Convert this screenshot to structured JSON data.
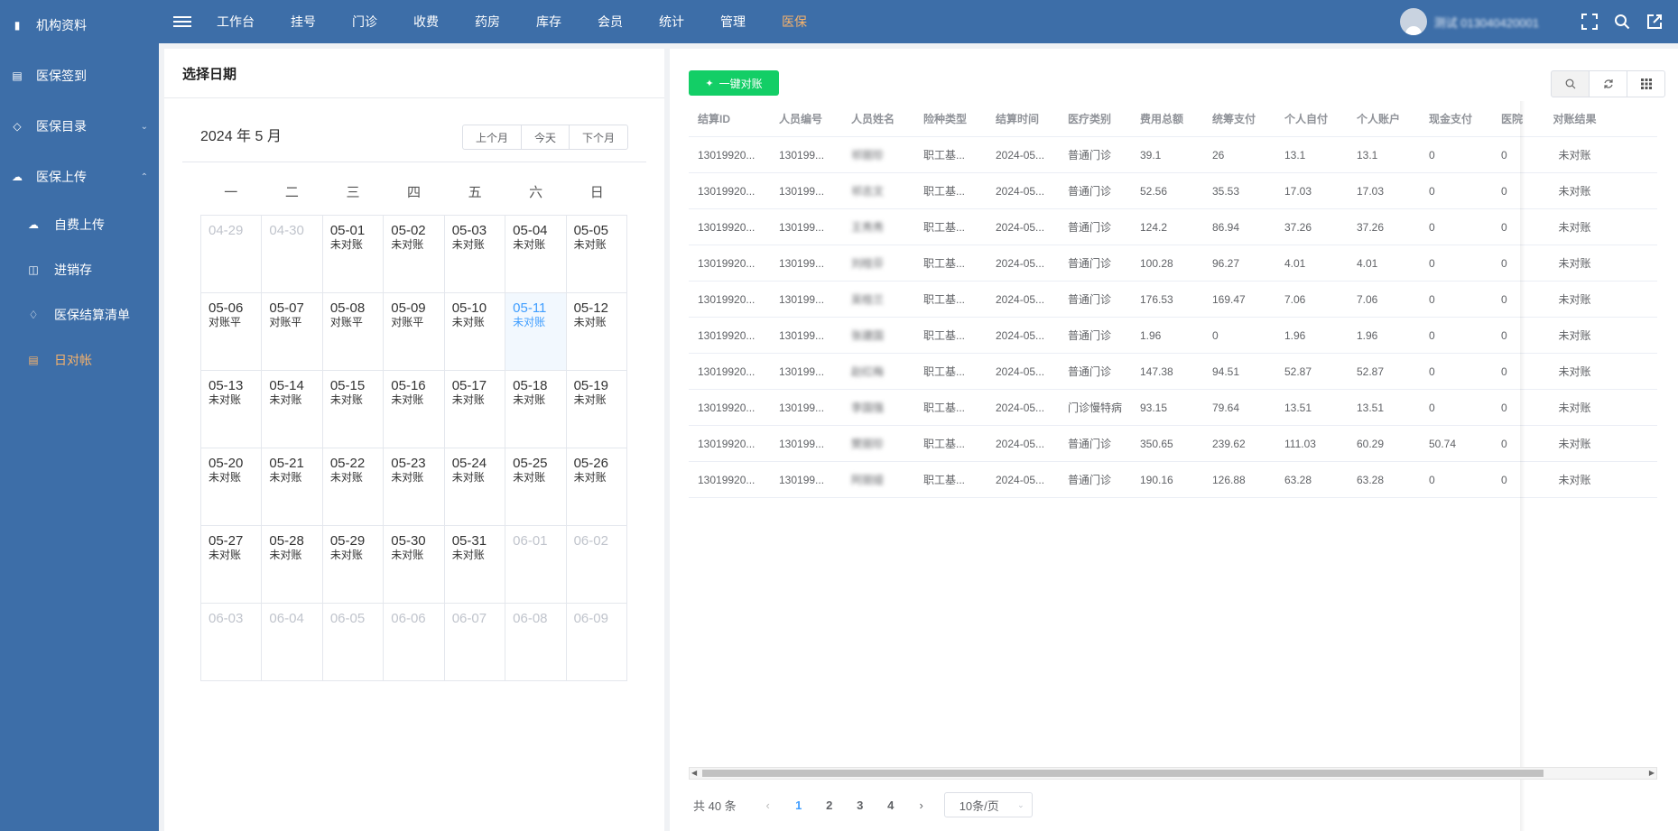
{
  "sidebar": {
    "items": [
      {
        "label": "机构资料",
        "icon": "clipboard-icon"
      },
      {
        "label": "医保签到",
        "icon": "id-card-icon"
      },
      {
        "label": "医保目录",
        "icon": "catalog-icon"
      },
      {
        "label": "医保上传",
        "icon": "cloud-upload-icon"
      }
    ],
    "sub_items": [
      {
        "label": "自费上传",
        "icon": "cloud-upload-icon"
      },
      {
        "label": "进销存",
        "icon": "boxes-icon"
      },
      {
        "label": "医保结算清单",
        "icon": "settlement-icon"
      },
      {
        "label": "日对帐",
        "icon": "document-icon",
        "active": true
      }
    ]
  },
  "topbar": {
    "nav": [
      "工作台",
      "挂号",
      "门诊",
      "收费",
      "药房",
      "库存",
      "会员",
      "统计",
      "管理",
      "医保"
    ],
    "active_nav": "医保",
    "username": "测试 013040420001"
  },
  "calendar": {
    "panel_title": "选择日期",
    "title": "2024 年 5 月",
    "buttons": {
      "prev": "上个月",
      "today": "今天",
      "next": "下个月"
    },
    "weekdays": [
      "一",
      "二",
      "三",
      "四",
      "五",
      "六",
      "日"
    ],
    "cells": [
      {
        "d": "04-29",
        "s": "",
        "other": true
      },
      {
        "d": "04-30",
        "s": "",
        "other": true
      },
      {
        "d": "05-01",
        "s": "未对账"
      },
      {
        "d": "05-02",
        "s": "未对账"
      },
      {
        "d": "05-03",
        "s": "未对账"
      },
      {
        "d": "05-04",
        "s": "未对账"
      },
      {
        "d": "05-05",
        "s": "未对账"
      },
      {
        "d": "05-06",
        "s": "对账平"
      },
      {
        "d": "05-07",
        "s": "对账平"
      },
      {
        "d": "05-08",
        "s": "对账平"
      },
      {
        "d": "05-09",
        "s": "对账平"
      },
      {
        "d": "05-10",
        "s": "未对账"
      },
      {
        "d": "05-11",
        "s": "未对账",
        "today": true
      },
      {
        "d": "05-12",
        "s": "未对账"
      },
      {
        "d": "05-13",
        "s": "未对账"
      },
      {
        "d": "05-14",
        "s": "未对账"
      },
      {
        "d": "05-15",
        "s": "未对账"
      },
      {
        "d": "05-16",
        "s": "未对账"
      },
      {
        "d": "05-17",
        "s": "未对账"
      },
      {
        "d": "05-18",
        "s": "未对账"
      },
      {
        "d": "05-19",
        "s": "未对账"
      },
      {
        "d": "05-20",
        "s": "未对账"
      },
      {
        "d": "05-21",
        "s": "未对账"
      },
      {
        "d": "05-22",
        "s": "未对账"
      },
      {
        "d": "05-23",
        "s": "未对账"
      },
      {
        "d": "05-24",
        "s": "未对账"
      },
      {
        "d": "05-25",
        "s": "未对账"
      },
      {
        "d": "05-26",
        "s": "未对账"
      },
      {
        "d": "05-27",
        "s": "未对账"
      },
      {
        "d": "05-28",
        "s": "未对账"
      },
      {
        "d": "05-29",
        "s": "未对账"
      },
      {
        "d": "05-30",
        "s": "未对账"
      },
      {
        "d": "05-31",
        "s": "未对账"
      },
      {
        "d": "06-01",
        "s": "",
        "other": true
      },
      {
        "d": "06-02",
        "s": "",
        "other": true
      },
      {
        "d": "06-03",
        "s": "",
        "other": true
      },
      {
        "d": "06-04",
        "s": "",
        "other": true
      },
      {
        "d": "06-05",
        "s": "",
        "other": true
      },
      {
        "d": "06-06",
        "s": "",
        "other": true
      },
      {
        "d": "06-07",
        "s": "",
        "other": true
      },
      {
        "d": "06-08",
        "s": "",
        "other": true
      },
      {
        "d": "06-09",
        "s": "",
        "other": true
      }
    ]
  },
  "table": {
    "reconcile_button": "一键对账",
    "columns": [
      "结算ID",
      "人员编号",
      "人员姓名",
      "险种类型",
      "结算时间",
      "医疗类别",
      "费用总额",
      "统筹支付",
      "个人自付",
      "个人账户",
      "现金支付",
      "医院",
      "对账结果"
    ],
    "rows": [
      [
        "13019920...",
        "130199...",
        "祁丽珍",
        "职工基...",
        "2024-05...",
        "普通门诊",
        "39.1",
        "26",
        "13.1",
        "13.1",
        "0",
        "0",
        "未对账"
      ],
      [
        "13019920...",
        "130199...",
        "祁志文",
        "职工基...",
        "2024-05...",
        "普通门诊",
        "52.56",
        "35.53",
        "17.03",
        "17.03",
        "0",
        "0",
        "未对账"
      ],
      [
        "13019920...",
        "130199...",
        "王秀秀",
        "职工基...",
        "2024-05...",
        "普通门诊",
        "124.2",
        "86.94",
        "37.26",
        "37.26",
        "0",
        "0",
        "未对账"
      ],
      [
        "13019920...",
        "130199...",
        "刘桂芬",
        "职工基...",
        "2024-05...",
        "普通门诊",
        "100.28",
        "96.27",
        "4.01",
        "4.01",
        "0",
        "0",
        "未对账"
      ],
      [
        "13019920...",
        "130199...",
        "吴桂兰",
        "职工基...",
        "2024-05...",
        "普通门诊",
        "176.53",
        "169.47",
        "7.06",
        "7.06",
        "0",
        "0",
        "未对账"
      ],
      [
        "13019920...",
        "130199...",
        "张建国",
        "职工基...",
        "2024-05...",
        "普通门诊",
        "1.96",
        "0",
        "1.96",
        "1.96",
        "0",
        "0",
        "未对账"
      ],
      [
        "13019920...",
        "130199...",
        "赵红梅",
        "职工基...",
        "2024-05...",
        "普通门诊",
        "147.38",
        "94.51",
        "52.87",
        "52.87",
        "0",
        "0",
        "未对账"
      ],
      [
        "13019920...",
        "130199...",
        "李国强",
        "职工基...",
        "2024-05...",
        "门诊慢特病",
        "93.15",
        "79.64",
        "13.51",
        "13.51",
        "0",
        "0",
        "未对账"
      ],
      [
        "13019920...",
        "130199...",
        "樊丽珍",
        "职工基...",
        "2024-05...",
        "普通门诊",
        "350.65",
        "239.62",
        "111.03",
        "60.29",
        "50.74",
        "0",
        "未对账"
      ],
      [
        "13019920...",
        "130199...",
        "阿丽娅",
        "职工基...",
        "2024-05...",
        "普通门诊",
        "190.16",
        "126.88",
        "63.28",
        "63.28",
        "0",
        "0",
        "未对账"
      ]
    ]
  },
  "pager": {
    "total": "共 40 条",
    "pages": [
      "1",
      "2",
      "3",
      "4"
    ],
    "active_page": "1",
    "page_size": "10条/页"
  }
}
